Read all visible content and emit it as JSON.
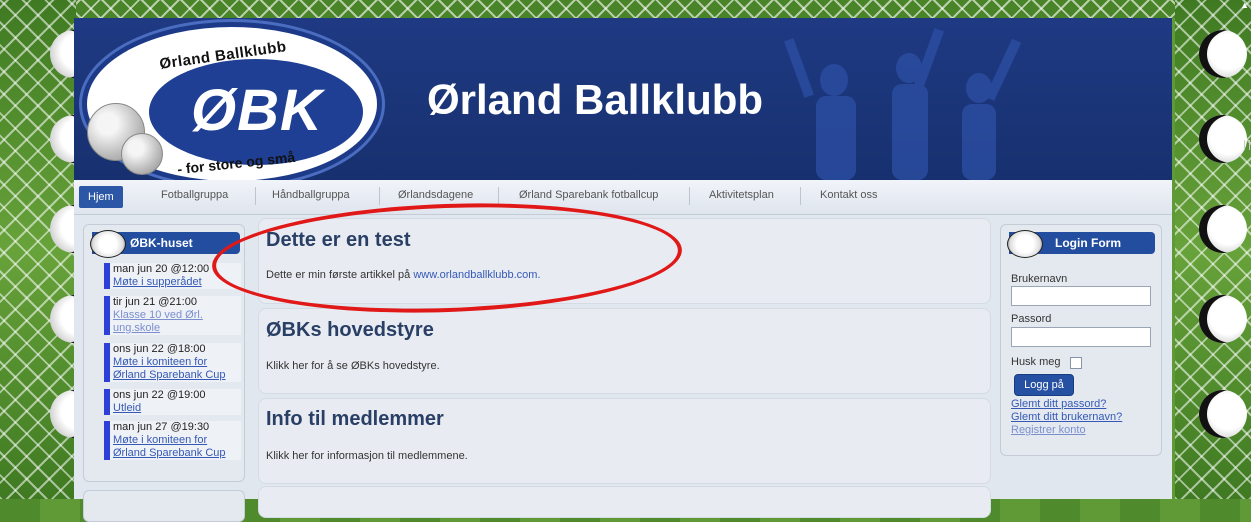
{
  "site": {
    "title": "Ørland Ballklubb",
    "logo": {
      "name": "Ørland Ballklubb",
      "abbr": "ØBK",
      "slogan": "- for store og små"
    }
  },
  "nav": {
    "items": [
      "Hjem",
      "Fotballgruppa",
      "Håndballgruppa",
      "Ørlandsdagene",
      "Ørland Sparebank fotballcup",
      "Aktivitetsplan",
      "Kontakt oss"
    ],
    "active": "Hjem"
  },
  "events_module": {
    "title": "ØBK-huset",
    "events": [
      {
        "date": "man jun 20 @12:00",
        "title": "Møte i supperådet"
      },
      {
        "date": "tir jun 21 @21:00",
        "title": "Klasse 10 ved Ørl. ung.skole"
      },
      {
        "date": "ons jun 22 @18:00",
        "title": "Møte i komiteen for Ørland Sparebank Cup"
      },
      {
        "date": "ons jun 22 @19:00",
        "title": "Utleid"
      },
      {
        "date": "man jun 27 @19:30",
        "title": "Møte i komiteen for Ørland Sparebank Cup"
      }
    ]
  },
  "articles": [
    {
      "title": "Dette er en test",
      "text": "Dette er min første artikkel på",
      "link": "www.orlandballklubb.com."
    },
    {
      "title": "ØBKs hovedstyre",
      "text": "Klikk her for å se ØBKs hovedstyre."
    },
    {
      "title": "Info til medlemmer",
      "text": "Klikk her for informasjon til medlemmene."
    }
  ],
  "login": {
    "title": "Login Form",
    "username_label": "Brukernavn",
    "username_value": "",
    "password_label": "Passord",
    "password_value": "",
    "remember_label": "Husk meg",
    "remember_checked": false,
    "submit_label": "Logg på",
    "forgot_password": "Glemt ditt passord?",
    "forgot_username": "Glemt ditt brukernavn?",
    "register": "Registrer konto"
  },
  "colors": {
    "header": "#1f3a83",
    "accent": "#234ea0",
    "annotation": "#e11818"
  }
}
